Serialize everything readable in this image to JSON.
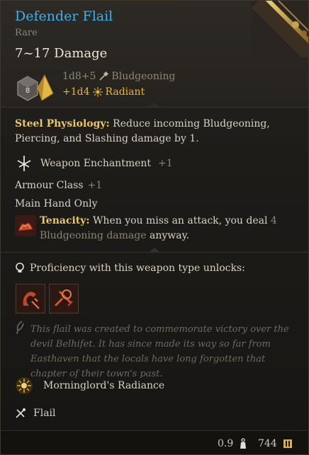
{
  "item": {
    "name": "Defender Flail",
    "rarity": "Rare",
    "damage_total": "7~17 Damage",
    "die_face": "8",
    "damage_base": "1d8+5",
    "damage_base_type": "Bludgeoning",
    "damage_bonus": "+1d4",
    "damage_bonus_type": "Radiant"
  },
  "properties": {
    "steel_physiology_label": "Steel Physiology:",
    "steel_physiology_text": "Reduce incoming Bludgeoning, Piercing, and Slashing damage by 1.",
    "enchantment_label": "Weapon Enchantment",
    "enchantment_value": "+1",
    "armour_class_label": "Armour Class",
    "armour_class_value": "+1",
    "hand": "Main Hand Only",
    "tenacity_label": "Tenacity:",
    "tenacity_text_a": "When you miss an attack, you deal",
    "tenacity_amount": "4",
    "tenacity_damage_type": "Bludgeoning damage",
    "tenacity_text_b": "anyway."
  },
  "proficiency": {
    "title": "Proficiency with this weapon type unlocks:"
  },
  "lore": {
    "text": "This flail was created to commemorate victory over the devil Belhifet. It has since made its way so far from Easthaven that the locals have long forgotten that chapter of their town's past."
  },
  "extras": {
    "passive_name": "Morninglord's Radiance",
    "weapon_type": "Flail"
  },
  "footer": {
    "weight": "0.9",
    "value": "744"
  },
  "colors": {
    "name": "#3fb0e8",
    "radiant": "#e8b53c",
    "keyword": "#e9c86c",
    "enchant_value": "#8a8376"
  }
}
